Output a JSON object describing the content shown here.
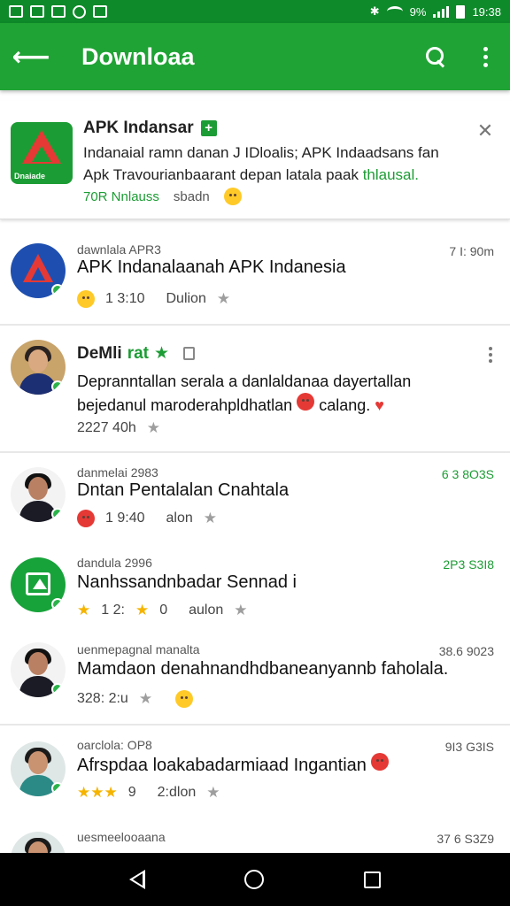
{
  "status_bar": {
    "battery": "9%",
    "time": "19:38"
  },
  "app_bar": {
    "title": "Downloaa"
  },
  "promo": {
    "title": "APK Indansar",
    "description_line1": "Indanaial ramn danan J IDloalis; APK Indaadsans fan",
    "description_line2_a": "Apk Travourianbaarant depan latala paak",
    "description_line2_b": "thlausal.",
    "meta_green": "70R Nnlauss",
    "meta_grey": "sbadn"
  },
  "items": [
    {
      "subtitle": "dawnlala APR3",
      "time": "7 I: 90m",
      "headline": "APK Indanalaanah APK Indanesia",
      "meta_time": "1 3:10",
      "meta_label": "Dulion"
    },
    {
      "name": "DeMli",
      "name_green": "rat",
      "body": "Depranntallan serala a danlaldanaa dayertallan bejedanul maroderahpldhatlan",
      "body_end": "calang.",
      "meta_time": "2227 40h"
    },
    {
      "subtitle": "danmelai 2983",
      "time": "6 3 8O3S",
      "headline": "Dntan Pentalalan Cnahtala",
      "meta_time": "1 9:40",
      "meta_label": "alon"
    },
    {
      "subtitle": "dandula 2996",
      "time": "2P3 S3I8",
      "headline": "Nanhssandnbadar Sennad i",
      "meta_time": "1 2:",
      "meta_num": "0",
      "meta_label": "aulon"
    },
    {
      "subtitle": "uenmepagnal manalta",
      "time": "38.6 9023",
      "headline": "Mamdaon denahnandhdbaneanyannb faholala.",
      "meta_time": "328: 2:u"
    },
    {
      "subtitle": "oarclola: OP8",
      "time": "9I3 G3IS",
      "headline": "Afrspdaa loakabadarmiaad Ingantian",
      "meta_num": "9",
      "meta_label": "2:dlon"
    },
    {
      "subtitle": "uesmeelooaana",
      "time": "37 6 S3Z9"
    }
  ]
}
